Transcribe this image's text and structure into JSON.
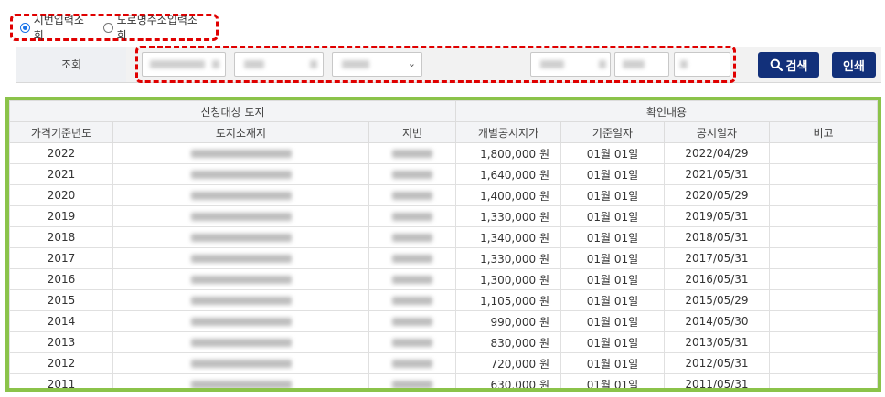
{
  "search_mode": {
    "options": [
      {
        "label": "지번입력조회",
        "checked": true
      },
      {
        "label": "도로명주소입력조회",
        "checked": false
      }
    ]
  },
  "search": {
    "label": "조회",
    "search_button": "검색",
    "print_button": "인쇄"
  },
  "table": {
    "group_headers": [
      "신청대상 토지",
      "확인내용"
    ],
    "columns": [
      "가격기준년도",
      "토지소재지",
      "지번",
      "개별공시지가",
      "기준일자",
      "공시일자",
      "비고"
    ],
    "rows": [
      {
        "year": "2022",
        "price": "1,800,000 원",
        "base_date": "01월 01일",
        "announce_date": "2022/04/29"
      },
      {
        "year": "2021",
        "price": "1,640,000 원",
        "base_date": "01월 01일",
        "announce_date": "2021/05/31"
      },
      {
        "year": "2020",
        "price": "1,400,000 원",
        "base_date": "01월 01일",
        "announce_date": "2020/05/29"
      },
      {
        "year": "2019",
        "price": "1,330,000 원",
        "base_date": "01월 01일",
        "announce_date": "2019/05/31"
      },
      {
        "year": "2018",
        "price": "1,340,000 원",
        "base_date": "01월 01일",
        "announce_date": "2018/05/31"
      },
      {
        "year": "2017",
        "price": "1,330,000 원",
        "base_date": "01월 01일",
        "announce_date": "2017/05/31"
      },
      {
        "year": "2016",
        "price": "1,300,000 원",
        "base_date": "01월 01일",
        "announce_date": "2016/05/31"
      },
      {
        "year": "2015",
        "price": "1,105,000 원",
        "base_date": "01월 01일",
        "announce_date": "2015/05/29"
      },
      {
        "year": "2014",
        "price": "990,000 원",
        "base_date": "01월 01일",
        "announce_date": "2014/05/30"
      },
      {
        "year": "2013",
        "price": "830,000 원",
        "base_date": "01월 01일",
        "announce_date": "2013/05/31"
      },
      {
        "year": "2012",
        "price": "720,000 원",
        "base_date": "01월 01일",
        "announce_date": "2012/05/31"
      },
      {
        "year": "2011",
        "price": "630,000 원",
        "base_date": "01월 01일",
        "announce_date": "2011/05/31"
      }
    ]
  },
  "colors": {
    "accent": "#12307a",
    "highlight_red": "#e00000",
    "highlight_green": "#8bc34a",
    "radio_blue": "#1a73e8"
  }
}
